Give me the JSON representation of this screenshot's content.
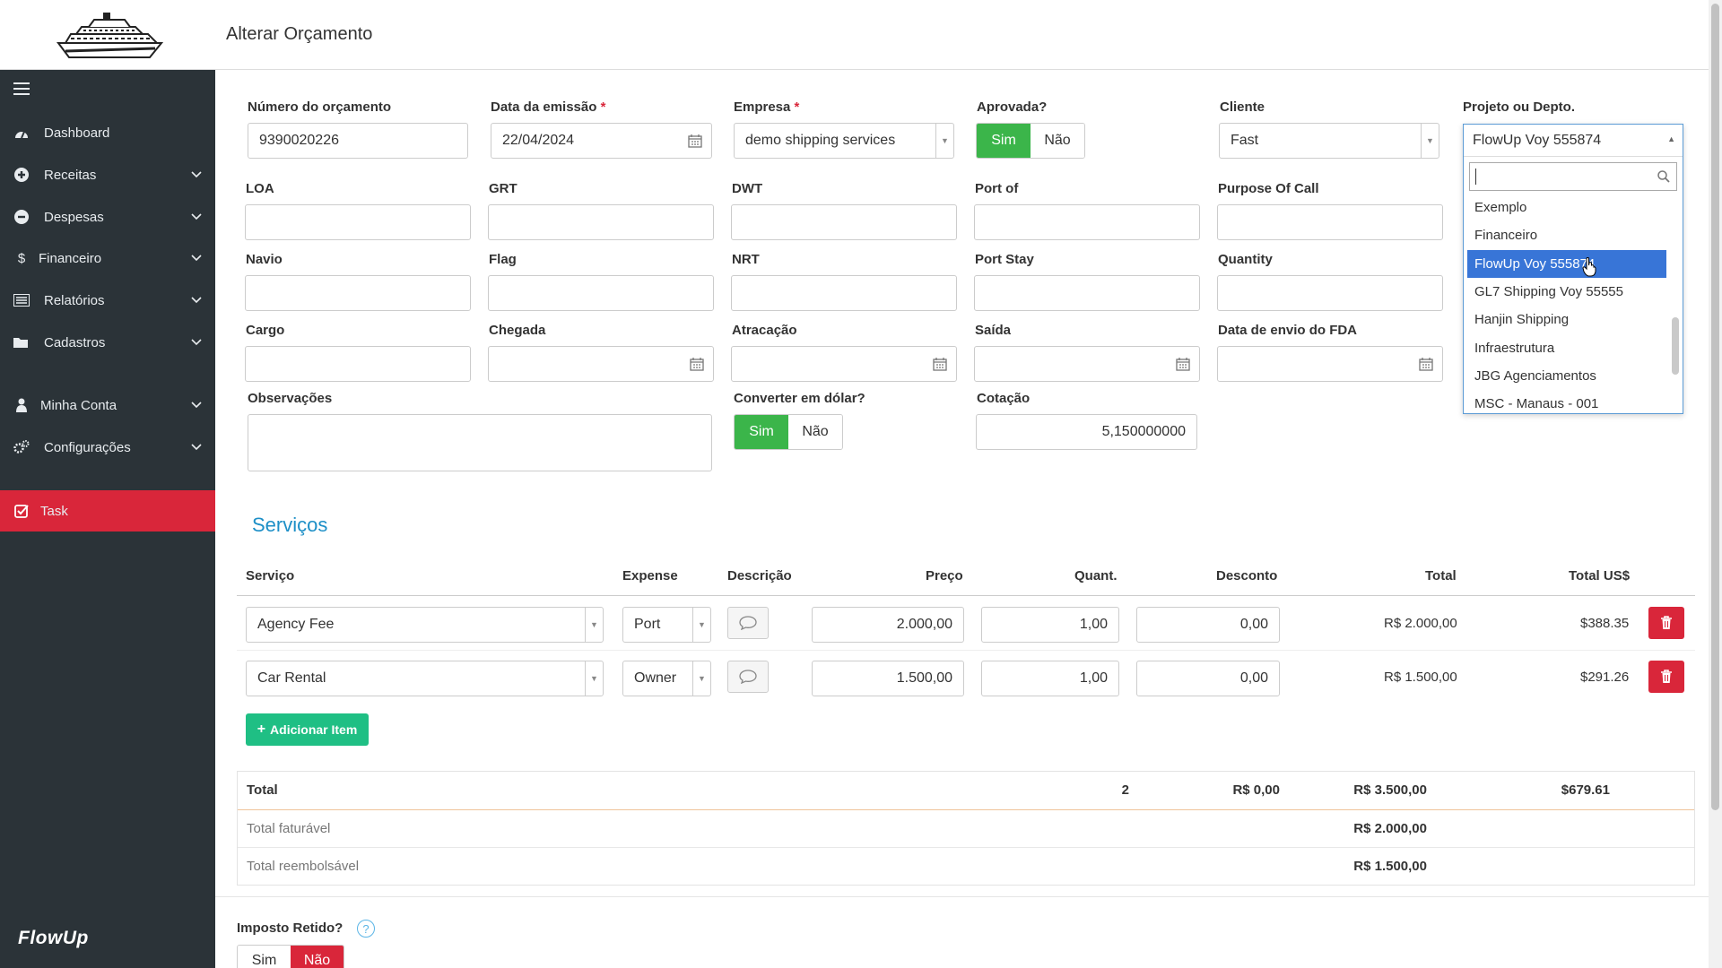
{
  "header": {
    "title": "Alterar Orçamento"
  },
  "sidebar": {
    "items": [
      {
        "label": "Dashboard",
        "icon": "dashboard-icon"
      },
      {
        "label": "Receitas",
        "icon": "plus-circle-icon"
      },
      {
        "label": "Despesas",
        "icon": "minus-circle-icon"
      },
      {
        "label": "Financeiro",
        "icon": "dollar-icon"
      },
      {
        "label": "Relatórios",
        "icon": "report-icon"
      },
      {
        "label": "Cadastros",
        "icon": "folder-icon"
      },
      {
        "label": "Minha Conta",
        "icon": "user-icon"
      },
      {
        "label": "Configurações",
        "icon": "gears-icon"
      },
      {
        "label": "Task",
        "icon": "check-square-icon"
      }
    ],
    "brand": "FlowUp",
    "task_color": "#d9263a"
  },
  "form": {
    "numero": {
      "label": "Número do orçamento",
      "value": "9390020226"
    },
    "emissao": {
      "label": "Data da emissão",
      "required": "*",
      "value": "22/04/2024"
    },
    "empresa": {
      "label": "Empresa",
      "required": "*",
      "value": "demo shipping services"
    },
    "aprovada": {
      "label": "Aprovada?",
      "yes": "Sim",
      "no": "Não",
      "selected": "Sim"
    },
    "cliente": {
      "label": "Cliente",
      "value": "Fast"
    },
    "projeto": {
      "label": "Projeto ou Depto.",
      "value": "FlowUp Voy 555874"
    },
    "loa": {
      "label": "LOA",
      "value": ""
    },
    "grt": {
      "label": "GRT",
      "value": ""
    },
    "dwt": {
      "label": "DWT",
      "value": ""
    },
    "port_of": {
      "label": "Port of",
      "value": ""
    },
    "purpose": {
      "label": "Purpose Of Call",
      "value": ""
    },
    "navio": {
      "label": "Navio",
      "value": ""
    },
    "flag": {
      "label": "Flag",
      "value": ""
    },
    "nrt": {
      "label": "NRT",
      "value": ""
    },
    "port_stay": {
      "label": "Port Stay",
      "value": ""
    },
    "quantity": {
      "label": "Quantity",
      "value": ""
    },
    "cargo": {
      "label": "Cargo",
      "value": ""
    },
    "chegada": {
      "label": "Chegada",
      "value": ""
    },
    "atracacao": {
      "label": "Atracação",
      "value": ""
    },
    "saida": {
      "label": "Saída",
      "value": ""
    },
    "fda": {
      "label": "Data de envio do FDA",
      "value": ""
    },
    "observacoes": {
      "label": "Observações",
      "value": ""
    },
    "converter": {
      "label": "Converter em dólar?",
      "yes": "Sim",
      "no": "Não",
      "selected": "Sim"
    },
    "cotacao": {
      "label": "Cotação",
      "value": "5,150000000"
    }
  },
  "projeto_dropdown": {
    "selected": "FlowUp Voy 555874",
    "search_value": "",
    "options": [
      "Exemplo",
      "Financeiro",
      "FlowUp Voy 555874",
      "GL7 Shipping Voy 55555",
      "Hanjin Shipping",
      "Infraestrutura",
      "JBG Agenciamentos",
      "MSC - Manaus - 001"
    ],
    "highlighted_index": 2
  },
  "servicos": {
    "title": "Serviços",
    "columns": [
      "Serviço",
      "Expense",
      "Descrição",
      "Preço",
      "Quant.",
      "Desconto",
      "Total",
      "Total US$"
    ],
    "rows": [
      {
        "servico": "Agency Fee",
        "expense": "Port",
        "preco": "2.000,00",
        "quant": "1,00",
        "desconto": "0,00",
        "total": "R$ 2.000,00",
        "total_usd": "$388.35"
      },
      {
        "servico": "Car Rental",
        "expense": "Owner",
        "preco": "1.500,00",
        "quant": "1,00",
        "desconto": "0,00",
        "total": "R$ 1.500,00",
        "total_usd": "$291.26"
      }
    ],
    "add_label": "Adicionar Item",
    "totals": {
      "label": "Total",
      "quant": "2",
      "desconto": "R$ 0,00",
      "total": "R$ 3.500,00",
      "total_usd": "$679.61",
      "faturavel_label": "Total faturável",
      "faturavel": "R$ 2.000,00",
      "reembolsavel_label": "Total reembolsável",
      "reembolsavel": "R$ 1.500,00"
    }
  },
  "imposto": {
    "label": "Imposto Retido?",
    "yes": "Sim",
    "no": "Não",
    "selected": "Não",
    "help": "?"
  },
  "colors": {
    "green": "#3bb54a",
    "red": "#d9263a",
    "blue_title": "#1d8fc7",
    "add_green": "#1fbf84",
    "highlight": "#3875d7"
  }
}
